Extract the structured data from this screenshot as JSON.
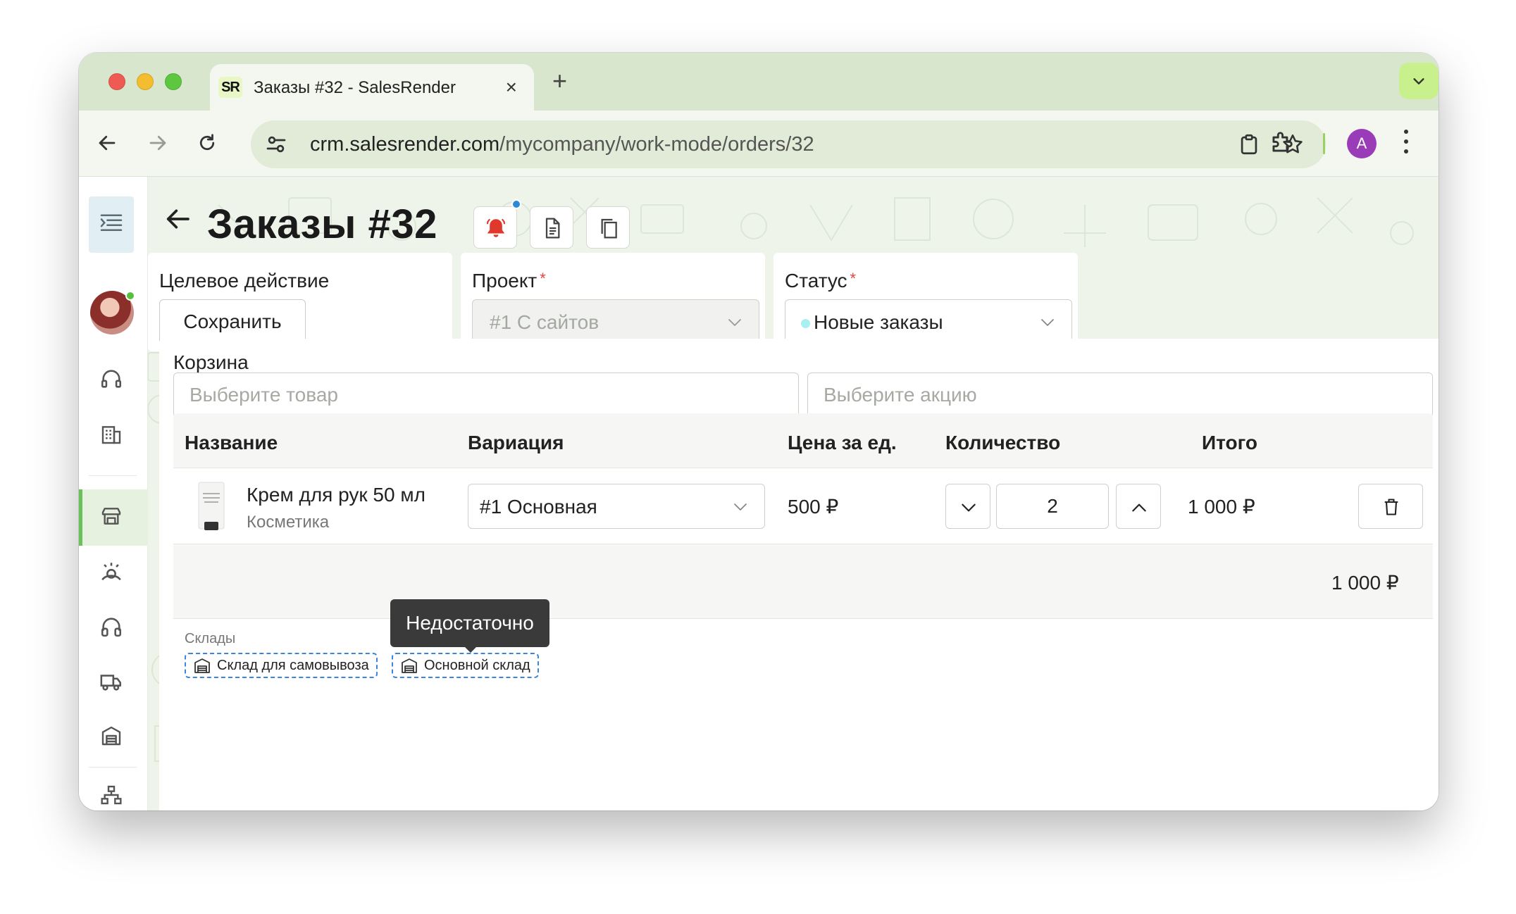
{
  "browser": {
    "tab_favicon": "SR",
    "tab_title": "Заказы #32 - SalesRender",
    "tab_close": "×",
    "new_tab": "+",
    "url_host": "crm.salesrender.com",
    "url_path": "/mycompany/work-mode/orders/32",
    "profile_initial": "A",
    "icons": [
      "back-icon",
      "forward-icon",
      "reload-icon",
      "site-settings-icon",
      "clipboard-icon",
      "star-icon",
      "extensions-icon",
      "more-icon",
      "tab-list-icon"
    ]
  },
  "sidebar": {
    "items": [
      "collapse-menu",
      "user-avatar",
      "headset",
      "building",
      "store",
      "support-person",
      "headphones",
      "truck",
      "warehouse",
      "structure"
    ],
    "active_item": "store",
    "accent_color": "#6cc25a"
  },
  "header": {
    "title": "Заказы #32"
  },
  "target_action": {
    "label": "Целевое действие",
    "save_button": "Сохранить"
  },
  "project": {
    "label": "Проект",
    "required_mark": "*",
    "value": "#1 С сайтов"
  },
  "status": {
    "label": "Статус",
    "required_mark": "*",
    "value": "Новые заказы",
    "dot_color": "#a8eef2"
  },
  "cart": {
    "label": "Корзина",
    "product_placeholder": "Выберите товар",
    "promo_placeholder": "Выберите акцию",
    "columns": [
      "Название",
      "Вариация",
      "Цена за ед.",
      "Количество",
      "Итого"
    ],
    "rows": [
      {
        "name": "Крем для рук 50 мл",
        "category": "Косметика",
        "variation": "#1 Основная",
        "price": "500 ₽",
        "quantity": "2",
        "total": "1 000 ₽"
      }
    ],
    "grand_total": "1 000 ₽"
  },
  "warehouses": {
    "label": "Склады",
    "items": [
      "Склад для самовывоза",
      "Основной склад"
    ],
    "tooltip": "Недостаточно"
  }
}
